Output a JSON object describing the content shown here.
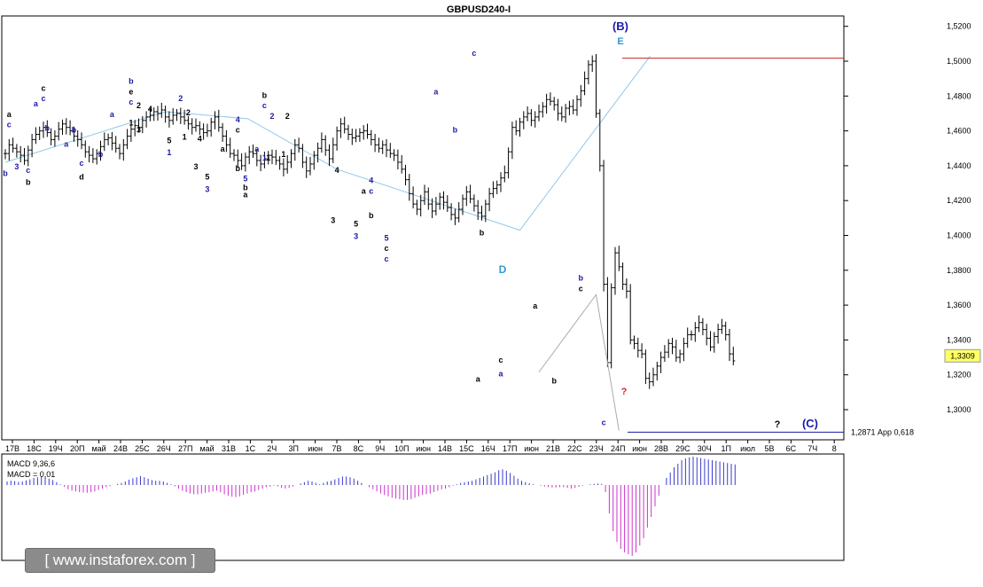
{
  "chart_data": {
    "type": "ohlc",
    "title": "GBPUSD240-I",
    "ylim": [
      1.28,
      1.53
    ],
    "yticks": [
      1.3,
      1.32,
      1.34,
      1.36,
      1.38,
      1.4,
      1.42,
      1.44,
      1.46,
      1.48,
      1.5,
      1.52
    ],
    "ytick_labels": [
      "1,3000",
      "1,3200",
      "1,3400",
      "1,3600",
      "1,3800",
      "1,4000",
      "1,4200",
      "1,4400",
      "1,4600",
      "1,4800",
      "1,5000",
      "1,5200"
    ],
    "x_tick_labels": [
      "17В",
      "18С",
      "19Ч",
      "20П",
      "май",
      "24В",
      "25С",
      "26Ч",
      "27П",
      "май",
      "31В",
      "1С",
      "2Ч",
      "3П",
      "июн",
      "7В",
      "8С",
      "9Ч",
      "10П",
      "июн",
      "14В",
      "15С",
      "16Ч",
      "17П",
      "июн",
      "21В",
      "22С",
      "23Ч",
      "24П",
      "июн",
      "28В",
      "29С",
      "30Ч",
      "1П",
      "июл",
      "5В",
      "6С",
      "7Ч",
      "8"
    ],
    "current_price": "1,3309",
    "target_label": "1,2871 Арр 0,618",
    "target_level": 1.2871,
    "high_level": 1.5017,
    "forecast_path": [
      [
        28,
        1.3215
      ],
      [
        31,
        1.366
      ],
      [
        32.2,
        1.288
      ]
    ],
    "wave_path_light_blue": [
      [
        0,
        1.442
      ],
      [
        7,
        1.471
      ],
      [
        10.6,
        1.467
      ],
      [
        14.5,
        1.438
      ],
      [
        22.5,
        1.403
      ],
      [
        28.2,
        1.503
      ]
    ],
    "series": [
      {
        "name": "",
        "values": [
          1.447,
          1.452,
          1.45,
          1.448,
          1.446,
          1.443,
          1.449,
          1.455,
          1.458,
          1.46,
          1.462,
          1.459,
          1.455,
          1.457,
          1.461,
          1.464,
          1.462,
          1.46,
          1.457,
          1.455,
          1.452,
          1.448,
          1.446,
          1.444,
          1.447,
          1.451,
          1.455,
          1.456,
          1.453,
          1.45,
          1.447,
          1.452,
          1.457,
          1.461,
          1.463,
          1.462,
          1.466,
          1.468,
          1.469,
          1.471,
          1.47,
          1.472,
          1.468,
          1.466,
          1.469,
          1.47,
          1.468,
          1.466,
          1.464,
          1.462,
          1.463,
          1.461,
          1.459,
          1.46,
          1.465,
          1.468,
          1.462,
          1.457,
          1.452,
          1.447,
          1.446,
          1.443,
          1.44,
          1.445,
          1.448,
          1.447,
          1.443,
          1.441,
          1.444,
          1.446,
          1.445,
          1.443,
          1.441,
          1.438,
          1.442,
          1.447,
          1.452,
          1.45,
          1.442,
          1.437,
          1.441,
          1.446,
          1.45,
          1.455,
          1.449,
          1.444,
          1.452,
          1.46,
          1.464,
          1.461,
          1.458,
          1.456,
          1.457,
          1.459,
          1.46,
          1.458,
          1.455,
          1.452,
          1.45,
          1.452,
          1.449,
          1.447,
          1.446,
          1.442,
          1.438,
          1.432,
          1.424,
          1.418,
          1.415,
          1.42,
          1.425,
          1.418,
          1.414,
          1.418,
          1.422,
          1.419,
          1.416,
          1.412,
          1.41,
          1.415,
          1.421,
          1.425,
          1.421,
          1.417,
          1.413,
          1.411,
          1.418,
          1.424,
          1.427,
          1.429,
          1.433,
          1.436,
          1.448,
          1.462,
          1.46,
          1.465,
          1.468,
          1.47,
          1.466,
          1.468,
          1.471,
          1.474,
          1.478,
          1.477,
          1.475,
          1.47,
          1.468,
          1.473,
          1.474,
          1.472,
          1.478,
          1.483,
          1.49,
          1.498,
          1.5,
          1.47,
          1.44,
          1.372,
          1.327,
          1.37,
          1.39,
          1.382,
          1.372,
          1.368,
          1.34,
          1.338,
          1.334,
          1.332,
          1.318,
          1.316,
          1.32,
          1.325,
          1.33,
          1.333,
          1.338,
          1.336,
          1.33,
          1.332,
          1.338,
          1.343,
          1.343,
          1.347,
          1.35,
          1.346,
          1.341,
          1.336,
          1.342,
          1.346,
          1.348,
          1.343,
          1.332,
          1.328
        ]
      }
    ],
    "macd": {
      "label1": "MACD 9,36,6",
      "label2": "MACD = 0,01",
      "values": [
        0.1,
        0.12,
        0.11,
        0.09,
        0.1,
        0.13,
        0.16,
        0.2,
        0.22,
        0.25,
        0.22,
        0.18,
        0.14,
        0.08,
        0.02,
        -0.05,
        -0.12,
        -0.16,
        -0.18,
        -0.2,
        -0.21,
        -0.22,
        -0.2,
        -0.18,
        -0.14,
        -0.1,
        -0.06,
        -0.03,
        0.0,
        0.03,
        0.06,
        0.1,
        0.15,
        0.19,
        0.22,
        0.25,
        0.22,
        0.18,
        0.14,
        0.12,
        0.12,
        0.1,
        0.06,
        0.02,
        -0.04,
        -0.1,
        -0.16,
        -0.2,
        -0.24,
        -0.26,
        -0.26,
        -0.24,
        -0.22,
        -0.2,
        -0.18,
        -0.16,
        -0.2,
        -0.26,
        -0.3,
        -0.33,
        -0.34,
        -0.32,
        -0.28,
        -0.24,
        -0.2,
        -0.18,
        -0.14,
        -0.1,
        -0.06,
        -0.04,
        -0.02,
        -0.04,
        -0.08,
        -0.1,
        -0.08,
        -0.04,
        0.0,
        0.04,
        0.08,
        0.12,
        0.1,
        0.06,
        0.02,
        0.06,
        0.1,
        0.12,
        0.16,
        0.2,
        0.24,
        0.24,
        0.22,
        0.18,
        0.12,
        0.06,
        0.0,
        -0.06,
        -0.12,
        -0.18,
        -0.24,
        -0.28,
        -0.32,
        -0.36,
        -0.38,
        -0.4,
        -0.42,
        -0.42,
        -0.4,
        -0.36,
        -0.32,
        -0.28,
        -0.26,
        -0.24,
        -0.2,
        -0.16,
        -0.12,
        -0.1,
        -0.06,
        -0.02,
        0.02,
        0.06,
        0.08,
        0.1,
        0.12,
        0.16,
        0.2,
        0.24,
        0.28,
        0.32,
        0.36,
        0.42,
        0.44,
        0.4,
        0.34,
        0.26,
        0.18,
        0.12,
        0.08,
        0.05,
        0.02,
        0.0,
        -0.02,
        -0.04,
        -0.06,
        -0.07,
        -0.07,
        -0.06,
        -0.06,
        -0.08,
        -0.1,
        -0.08,
        -0.05,
        -0.02,
        0.0,
        0.02,
        0.03,
        0.04,
        0.03,
        -0.2,
        -0.8,
        -1.3,
        -1.6,
        -1.8,
        -1.9,
        -1.95,
        -2.0,
        -1.9,
        -1.7,
        -1.5,
        -1.2,
        -0.9,
        -0.6,
        -0.3,
        0.0,
        0.2,
        0.35,
        0.5,
        0.6,
        0.7,
        0.75,
        0.78,
        0.8,
        0.78,
        0.76,
        0.74,
        0.72,
        0.7,
        0.68,
        0.66,
        0.64,
        0.62,
        0.6,
        0.58
      ]
    }
  },
  "wave_labels": [
    {
      "t": "a",
      "i": 1,
      "p": 1.468,
      "c": "black"
    },
    {
      "t": "c",
      "i": 1,
      "p": 1.462,
      "c": "blue"
    },
    {
      "t": "b",
      "i": 0,
      "p": 1.434,
      "c": "blue"
    },
    {
      "t": "3",
      "i": 3,
      "p": 1.438,
      "c": "blue"
    },
    {
      "t": "c",
      "i": 6,
      "p": 1.436,
      "c": "blue"
    },
    {
      "t": "b",
      "i": 6,
      "p": 1.429,
      "c": "black"
    },
    {
      "t": "a",
      "i": 8,
      "p": 1.474,
      "c": "blue"
    },
    {
      "t": "c",
      "i": 10,
      "p": 1.483,
      "c": "black"
    },
    {
      "t": "c",
      "i": 10,
      "p": 1.477,
      "c": "blue"
    },
    {
      "t": "b",
      "i": 11,
      "p": 1.46,
      "c": "blue"
    },
    {
      "t": "a",
      "i": 16,
      "p": 1.451,
      "c": "blue"
    },
    {
      "t": "b",
      "i": 18,
      "p": 1.459,
      "c": "blue"
    },
    {
      "t": "c",
      "i": 20,
      "p": 1.44,
      "c": "blue"
    },
    {
      "t": "d",
      "i": 20,
      "p": 1.432,
      "c": "black"
    },
    {
      "t": "b",
      "i": 25,
      "p": 1.445,
      "c": "blue"
    },
    {
      "t": "a",
      "i": 28,
      "p": 1.468,
      "c": "blue"
    },
    {
      "t": "b",
      "i": 33,
      "p": 1.487,
      "c": "blue"
    },
    {
      "t": "e",
      "i": 33,
      "p": 1.481,
      "c": "black"
    },
    {
      "t": "c",
      "i": 33,
      "p": 1.475,
      "c": "blue"
    },
    {
      "t": "1",
      "i": 33,
      "p": 1.463,
      "c": "black"
    },
    {
      "t": "2",
      "i": 35,
      "p": 1.473,
      "c": "black"
    },
    {
      "t": "3",
      "i": 35,
      "p": 1.459,
      "c": "black"
    },
    {
      "t": "4",
      "i": 38,
      "p": 1.471,
      "c": "black"
    },
    {
      "t": "5",
      "i": 43,
      "p": 1.453,
      "c": "black"
    },
    {
      "t": "1",
      "i": 43,
      "p": 1.446,
      "c": "blue"
    },
    {
      "t": "2",
      "i": 46,
      "p": 1.477,
      "c": "blue"
    },
    {
      "t": "1",
      "i": 47,
      "p": 1.455,
      "c": "black"
    },
    {
      "t": "2",
      "i": 48,
      "p": 1.469,
      "c": "black"
    },
    {
      "t": "4",
      "i": 51,
      "p": 1.454,
      "c": "black"
    },
    {
      "t": "3",
      "i": 50,
      "p": 1.438,
      "c": "black"
    },
    {
      "t": "5",
      "i": 53,
      "p": 1.432,
      "c": "black"
    },
    {
      "t": "3",
      "i": 53,
      "p": 1.425,
      "c": "blue"
    },
    {
      "t": "a",
      "i": 57,
      "p": 1.448,
      "c": "black"
    },
    {
      "t": "4",
      "i": 61,
      "p": 1.465,
      "c": "blue"
    },
    {
      "t": "c",
      "i": 61,
      "p": 1.459,
      "c": "black"
    },
    {
      "t": "b",
      "i": 61,
      "p": 1.437,
      "c": "black"
    },
    {
      "t": "5",
      "i": 63,
      "p": 1.431,
      "c": "blue"
    },
    {
      "t": "b",
      "i": 63,
      "p": 1.426,
      "c": "black"
    },
    {
      "t": "a",
      "i": 63,
      "p": 1.422,
      "c": "black"
    },
    {
      "t": "a",
      "i": 66,
      "p": 1.448,
      "c": "blue"
    },
    {
      "t": "1",
      "i": 68,
      "p": 1.443,
      "c": "blue"
    },
    {
      "t": "b",
      "i": 68,
      "p": 1.479,
      "c": "black"
    },
    {
      "t": "c",
      "i": 68,
      "p": 1.473,
      "c": "blue"
    },
    {
      "t": "2",
      "i": 70,
      "p": 1.467,
      "c": "blue"
    },
    {
      "t": "1",
      "i": 69,
      "p": 1.443,
      "c": "black"
    },
    {
      "t": "2",
      "i": 74,
      "p": 1.467,
      "c": "black"
    },
    {
      "t": "1",
      "i": 73,
      "p": 1.445,
      "c": "black"
    },
    {
      "t": "4",
      "i": 87,
      "p": 1.436,
      "c": "black"
    },
    {
      "t": "3",
      "i": 86,
      "p": 1.407,
      "c": "black"
    },
    {
      "t": "4",
      "i": 96,
      "p": 1.43,
      "c": "blue"
    },
    {
      "t": "a",
      "i": 94,
      "p": 1.424,
      "c": "black"
    },
    {
      "t": "c",
      "i": 96,
      "p": 1.424,
      "c": "blue"
    },
    {
      "t": "b",
      "i": 96,
      "p": 1.41,
      "c": "black"
    },
    {
      "t": "5",
      "i": 92,
      "p": 1.405,
      "c": "black"
    },
    {
      "t": "3",
      "i": 92,
      "p": 1.398,
      "c": "blue"
    },
    {
      "t": "5",
      "i": 100,
      "p": 1.397,
      "c": "blue"
    },
    {
      "t": "c",
      "i": 100,
      "p": 1.391,
      "c": "black"
    },
    {
      "t": "c",
      "i": 100,
      "p": 1.385,
      "c": "blue"
    },
    {
      "t": "a",
      "i": 113,
      "p": 1.481,
      "c": "blue"
    },
    {
      "t": "b",
      "i": 118,
      "p": 1.459,
      "c": "blue"
    },
    {
      "t": "c",
      "i": 123,
      "p": 1.503,
      "c": "blue"
    },
    {
      "t": "b",
      "i": 125,
      "p": 1.4,
      "c": "black"
    },
    {
      "t": "a",
      "i": 124,
      "p": 1.316,
      "c": "black"
    },
    {
      "t": "c",
      "i": 130,
      "p": 1.327,
      "c": "black"
    },
    {
      "t": "a",
      "i": 130,
      "p": 1.319,
      "c": "blue"
    },
    {
      "t": "a",
      "i": 139,
      "p": 1.358,
      "c": "black"
    },
    {
      "t": "b",
      "i": 144,
      "p": 1.315,
      "c": "black"
    },
    {
      "t": "b",
      "i": 151,
      "p": 1.374,
      "c": "blue"
    },
    {
      "t": "c",
      "i": 151,
      "p": 1.368,
      "c": "black"
    },
    {
      "t": "c",
      "i": 157,
      "p": 1.291,
      "c": "blue"
    }
  ],
  "big_labels": [
    {
      "t": "(B)",
      "x": 700,
      "y": 34,
      "c": "#1a1aa6",
      "s": 13
    },
    {
      "t": "E",
      "x": 700,
      "y": 50,
      "c": "#3399cc",
      "s": 11
    },
    {
      "t": "D",
      "x": 567,
      "y": 308,
      "c": "#3399cc",
      "s": 12
    },
    {
      "t": "(C)",
      "x": 914,
      "y": 482,
      "c": "#1a1aa6",
      "s": 13
    },
    {
      "t": "?",
      "x": 704,
      "y": 445,
      "c": "#dd2222",
      "s": 11
    },
    {
      "t": "?",
      "x": 877,
      "y": 482,
      "c": "#000000",
      "s": 11
    }
  ],
  "brand_text": "[ www.instaforex.com ]"
}
